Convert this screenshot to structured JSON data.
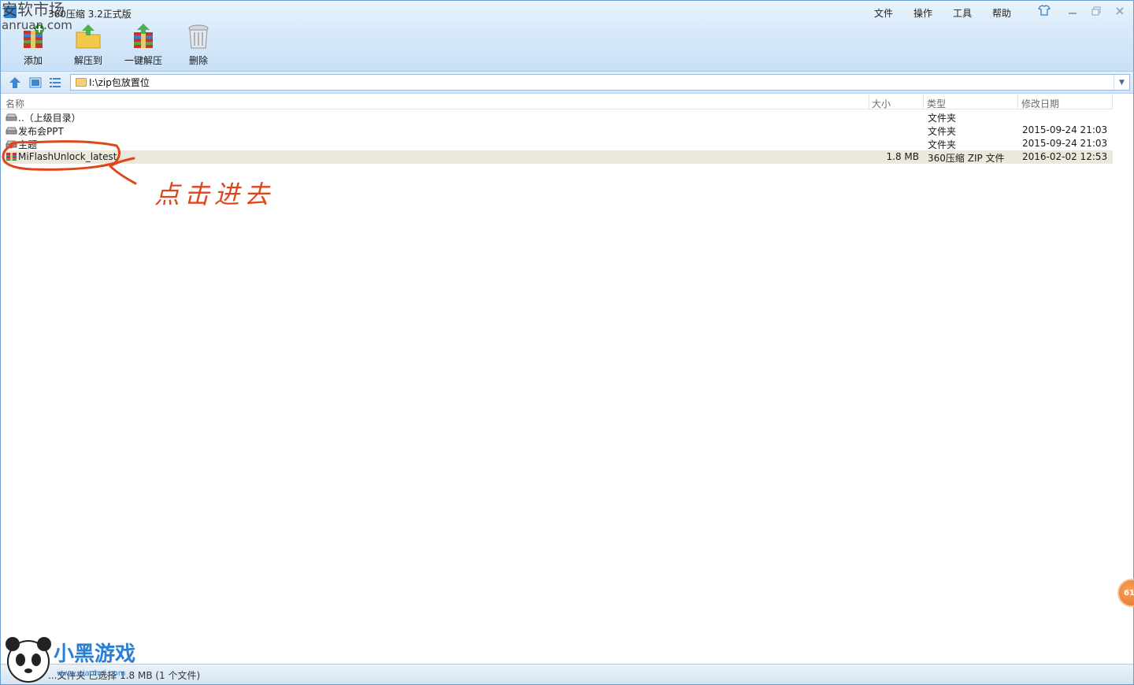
{
  "window": {
    "title": "360压缩 3.2正式版",
    "menu": [
      "文件",
      "操作",
      "工具",
      "帮助"
    ]
  },
  "toolbar": {
    "add_label": "添加",
    "extract_to_label": "解压到",
    "oneclick_label": "一键解压",
    "delete_label": "删除"
  },
  "navbar": {
    "path": "I:\\zip包放置位"
  },
  "list": {
    "headers": {
      "name": "名称",
      "size": "大小",
      "type": "类型",
      "date": "修改日期"
    },
    "rows": [
      {
        "name": "..（上级目录）",
        "size": "",
        "type": "文件夹",
        "date": "",
        "icon": "drive-icon"
      },
      {
        "name": "发布会PPT",
        "size": "",
        "type": "文件夹",
        "date": "2015-09-24 21:03",
        "icon": "drive-icon"
      },
      {
        "name": "主题",
        "size": "",
        "type": "文件夹",
        "date": "2015-09-24 21:03",
        "icon": "drive-icon"
      },
      {
        "name": "MiFlashUnlock_latest",
        "size": "1.8 MB",
        "type": "360压缩 ZIP 文件",
        "date": "2016-02-02 12:53",
        "icon": "zip-archive-icon"
      }
    ]
  },
  "status": {
    "text": "...文件夹 已选择 1.8 MB (1 个文件)"
  },
  "annotation": {
    "text": "点击进去"
  },
  "watermark": {
    "top_line1": "安软市场",
    "top_line2": "anruan.com",
    "bottom_text": "小黑游戏",
    "bottom_url": "www.xiaohei.com"
  },
  "badge": {
    "text": "61"
  },
  "colors": {
    "accent": "#3a7fc8",
    "annotation": "#e0461c",
    "selection": "#ebe9dc"
  }
}
